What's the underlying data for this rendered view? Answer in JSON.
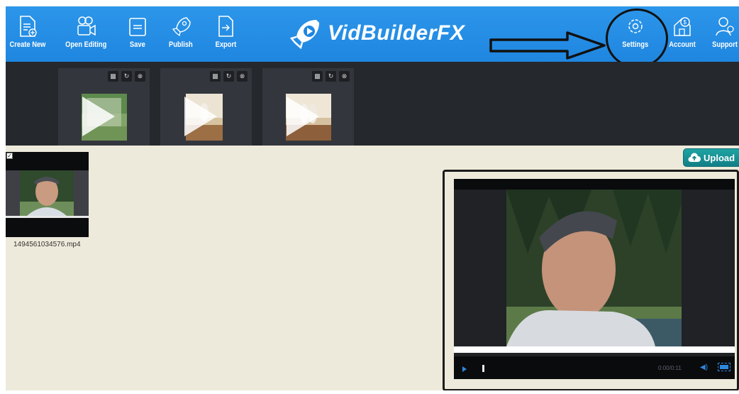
{
  "toolbar": {
    "items": [
      {
        "label": "Create New",
        "icon": "document-new-icon"
      },
      {
        "label": "Open Editing",
        "icon": "camera-icon"
      },
      {
        "label": "Save",
        "icon": "folder-icon"
      },
      {
        "label": "Publish",
        "icon": "rocket-icon"
      },
      {
        "label": "Export",
        "icon": "export-icon"
      },
      {
        "label": "Settings",
        "icon": "gear-icon"
      },
      {
        "label": "Account",
        "icon": "house-dollar-icon"
      },
      {
        "label": "Support",
        "icon": "support-icon"
      }
    ],
    "brand": "VidBuilderFX",
    "colors": {
      "bar": "#1f86e0",
      "text": "#ffffff"
    }
  },
  "templates": {
    "controls": [
      "lock-icon",
      "refresh-icon",
      "close-icon"
    ],
    "count": 3
  },
  "workspace": {
    "clip": {
      "filename": "1494561034576.mp4",
      "checked": true
    },
    "upload_label": "Upload"
  },
  "preview": {
    "time": "0:00/0:11"
  },
  "annotations": {
    "highlight_target": "Settings"
  }
}
